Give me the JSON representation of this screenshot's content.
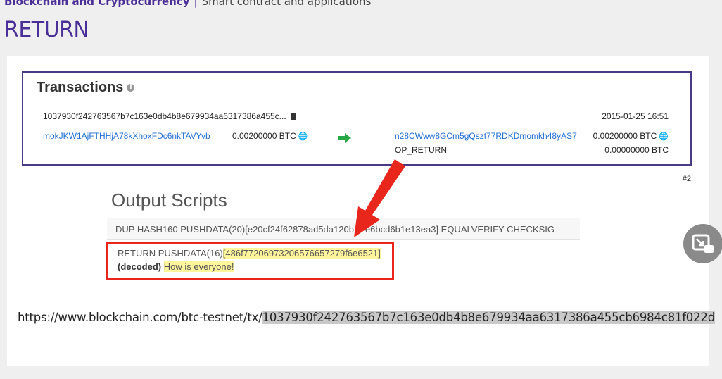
{
  "breadcrumb": {
    "section": "Blockchain and Cryptocurrency",
    "separator": "|",
    "topic": "Smart contract and applications"
  },
  "page_title": "RETURN",
  "transaction": {
    "heading": "Transactions",
    "hash": "1037930f242763567b7c163e0db4b8e679934aa6317386a455c...",
    "date": "2015-01-25 16:51",
    "input_address": "mokJKW1AjFTHHjA78kXhoxFDc6nkTAVYvb",
    "input_amount": "0.00200000 BTC",
    "output_address": "n28CWww8GCm5gQszt77RDKDmomkh48yAS7",
    "output_amount": "0.00200000 BTC",
    "op_return_label": "OP_RETURN",
    "op_return_amount": "0.00000000 BTC"
  },
  "slide_number": "#2",
  "output_scripts": {
    "heading": "Output Scripts",
    "line1": "DUP HASH160 PUSHDATA(20)[e20cf24f62878ad5da120b",
    "line1_tail": "e6bcd6b1e13ea3] EQUALVERIFY CHECKSIG",
    "line2_prefix": "RETURN PUSHDATA(16)",
    "line2_data": "[486f77206973206576657279f6e6521]",
    "decoded_label": "(decoded)",
    "decoded_text": "How is everyone!"
  },
  "url": {
    "prefix": "https://www.blockchain.com/btc-testnet/tx/",
    "hash": "1037930f242763567b7c163e0db4b8e679934aa6317386a455cb6984c81f022d"
  },
  "colors": {
    "accent": "#4b2f98",
    "link": "#1f6ed4",
    "highlight_box": "#e8261c",
    "arrow_green": "#27a846"
  },
  "icons": [
    "info-icon",
    "clipboard-icon",
    "globe-icon",
    "green-right-arrow-icon",
    "red-pointer-arrow",
    "picture-in-picture-icon"
  ]
}
